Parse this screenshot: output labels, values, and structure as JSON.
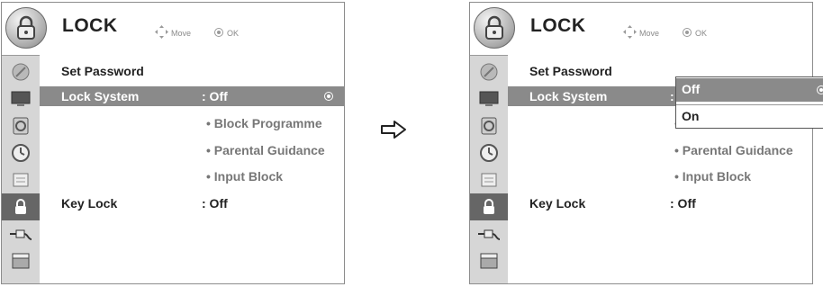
{
  "left": {
    "title": "LOCK",
    "hint_move": "Move",
    "hint_ok": "OK",
    "menu": {
      "set_password": "Set Password",
      "lock_system_label": "Lock System",
      "lock_system_value": ": Off",
      "block_programme": "• Block Programme",
      "parental_guidance": "• Parental Guidance",
      "input_block": "• Input Block",
      "key_lock_label": "Key Lock",
      "key_lock_value": ": Off"
    }
  },
  "right": {
    "title": "LOCK",
    "hint_move": "Move",
    "hint_ok": "OK",
    "menu": {
      "set_password": "Set Password",
      "lock_system_label": "Lock System",
      "lock_system_value": ": (",
      "block_programme_partial": "•",
      "parental_guidance": "• Parental Guidance",
      "input_block": "• Input Block",
      "key_lock_label": "Key Lock",
      "key_lock_value": ": Off"
    },
    "dropdown": {
      "options": [
        "Off",
        "On"
      ],
      "selected": "Off"
    }
  },
  "sidebar_icons": [
    "satellite-icon",
    "monitor-icon",
    "speaker-icon",
    "clock-icon",
    "option-icon",
    "lock-icon",
    "input-plug-icon",
    "clapper-icon"
  ],
  "active_sidebar_icon": "lock-icon",
  "colors": {
    "highlight": "#8a8a8a",
    "sidebar": "#d6d6d6",
    "sidebar_active": "#666666"
  }
}
